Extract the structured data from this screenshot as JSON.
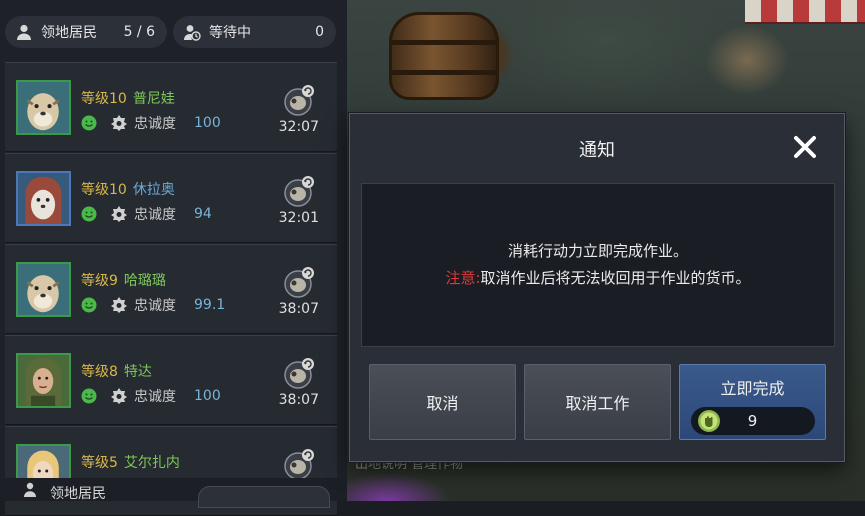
{
  "header": {
    "residents_label": "领地居民",
    "residents_count": "5 / 6",
    "waiting_label": "等待中",
    "waiting_count": "0"
  },
  "residents": [
    {
      "level": "等级10",
      "name": "普尼娃",
      "loyalty_label": "忠诚度",
      "loyalty": "100",
      "timer": "32:07"
    },
    {
      "level": "等级10",
      "name": "休拉奥",
      "loyalty_label": "忠诚度",
      "loyalty": "94",
      "timer": "32:01"
    },
    {
      "level": "等级9",
      "name": "哈璐璐",
      "loyalty_label": "忠诚度",
      "loyalty": "99.1",
      "timer": "38:07"
    },
    {
      "level": "等级8",
      "name": "特达",
      "loyalty_label": "忠诚度",
      "loyalty": "100",
      "timer": "38:07"
    },
    {
      "level": "等级5",
      "name": "艾尔扎内"
    }
  ],
  "footer": {
    "label": "领地居民"
  },
  "scene": {
    "bottom_text": "出地说明  管理作物"
  },
  "modal": {
    "title": "通知",
    "message_line1": "消耗行动力立即完成作业。",
    "warning_prefix": "注意:",
    "message_line2": "取消作业后将无法收回用于作业的货币。",
    "cancel_label": "取消",
    "cancel_work_label": "取消工作",
    "instant_label": "立即完成",
    "instant_cost": "9"
  },
  "colors": {
    "level": "#d8b84a",
    "name_green": "#7ec75a",
    "name_blue": "#6aaad8",
    "loyalty_value": "#7ab4d8",
    "warning": "#e03a3a",
    "primary_button": "#2c4878"
  },
  "icons": {
    "residents": "person-icon",
    "waiting": "pending-person-icon",
    "mood": "smile-icon",
    "loyalty": "gear-badge-icon",
    "work": "sheep-task-icon",
    "close": "close-icon",
    "cost": "fist-energy-icon"
  }
}
